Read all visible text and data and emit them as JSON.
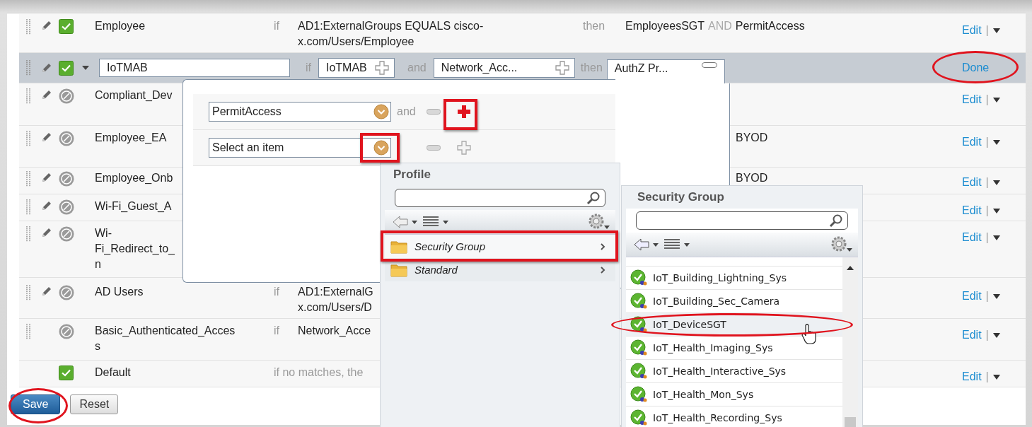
{
  "rules": [
    {
      "kind": "view",
      "draggable": true,
      "editable": true,
      "enabled": true,
      "name": "Employee",
      "if": "if",
      "condition": "AD1:ExternalGroups EQUALS cisco-\nx.com/Users/Employee",
      "then": "then",
      "result": [
        {
          "text": "EmployeesSGT",
          "kind": "value"
        },
        {
          "text": "AND",
          "kind": "operator"
        },
        {
          "text": "PermitAccess",
          "kind": "value"
        }
      ],
      "edit": "Edit",
      "separator": "|"
    },
    {
      "kind": "editing",
      "selected": true,
      "draggable": true,
      "editable": true,
      "enabled": true,
      "name_value": "IoTMAB",
      "if": "if",
      "conditions": [
        "IoTMAB",
        "Network_Acc..."
      ],
      "joiner": "and",
      "then": "then",
      "result_value": "AuthZ Pr...",
      "done": "Done"
    },
    {
      "kind": "view",
      "draggable": true,
      "editable": true,
      "enabled": false,
      "name": "Compliant_Dev",
      "edit": "Edit",
      "separator": "|"
    },
    {
      "kind": "view",
      "draggable": true,
      "editable": true,
      "enabled": false,
      "name": "Employee_EA",
      "result": [
        {
          "text": "BYOD",
          "kind": "value"
        }
      ],
      "edit": "Edit",
      "separator": "|"
    },
    {
      "kind": "view",
      "draggable": true,
      "editable": true,
      "enabled": false,
      "name": "Employee_Onb",
      "result": [
        {
          "text": "BYOD",
          "kind": "value"
        }
      ],
      "edit": "Edit",
      "separator": "|"
    },
    {
      "kind": "view",
      "draggable": true,
      "editable": true,
      "enabled": false,
      "name": "Wi-Fi_Guest_A",
      "edit": "Edit",
      "separator": "|"
    },
    {
      "kind": "view",
      "draggable": true,
      "editable": true,
      "enabled": false,
      "name": "Wi-\nFi_Redirect_to_\nn",
      "edit": "Edit",
      "separator": "|"
    },
    {
      "kind": "view",
      "draggable": true,
      "editable": true,
      "enabled": false,
      "name": "AD Users",
      "if": "if",
      "condition": "AD1:ExternalG\nx.com/Users/D",
      "edit": "Edit",
      "separator": "|"
    },
    {
      "kind": "view",
      "draggable": true,
      "editable": false,
      "enabled": false,
      "name": "Basic_Authenticated_Acces\ns",
      "if": "if",
      "condition": "Network_Acce",
      "edit": "Edit",
      "separator": "|"
    },
    {
      "kind": "view",
      "draggable": false,
      "editable": false,
      "enabled": true,
      "name": "Default",
      "fallback": "if no matches, the",
      "edit": "Edit",
      "separator": "|"
    }
  ],
  "buttons": [
    {
      "label": "Save",
      "kind": "primary"
    },
    {
      "label": "Reset",
      "kind": "secondary"
    }
  ],
  "results_popup": {
    "rows": [
      {
        "value": "PermitAccess",
        "joiner": "and"
      },
      {
        "placeholder": "Select an item"
      }
    ]
  },
  "profile_panel": {
    "title": "Profile",
    "items": [
      {
        "label": "Security Group",
        "selected": true
      },
      {
        "label": "Standard",
        "selected": false
      }
    ]
  },
  "security_panel": {
    "title": "Security Group",
    "items": [
      {
        "label": "IoT_Building_Lightning_Sys",
        "selected": false
      },
      {
        "label": "IoT_Building_Sec_Camera",
        "selected": false
      },
      {
        "label": "IoT_DeviceSGT",
        "selected": true
      },
      {
        "label": "IoT_Health_Imaging_Sys",
        "selected": false
      },
      {
        "label": "IoT_Health_Interactive_Sys",
        "selected": false
      },
      {
        "label": "IoT_Health_Mon_Sys",
        "selected": false
      },
      {
        "label": "IoT_Health_Recording_Sys",
        "selected": false
      }
    ]
  }
}
